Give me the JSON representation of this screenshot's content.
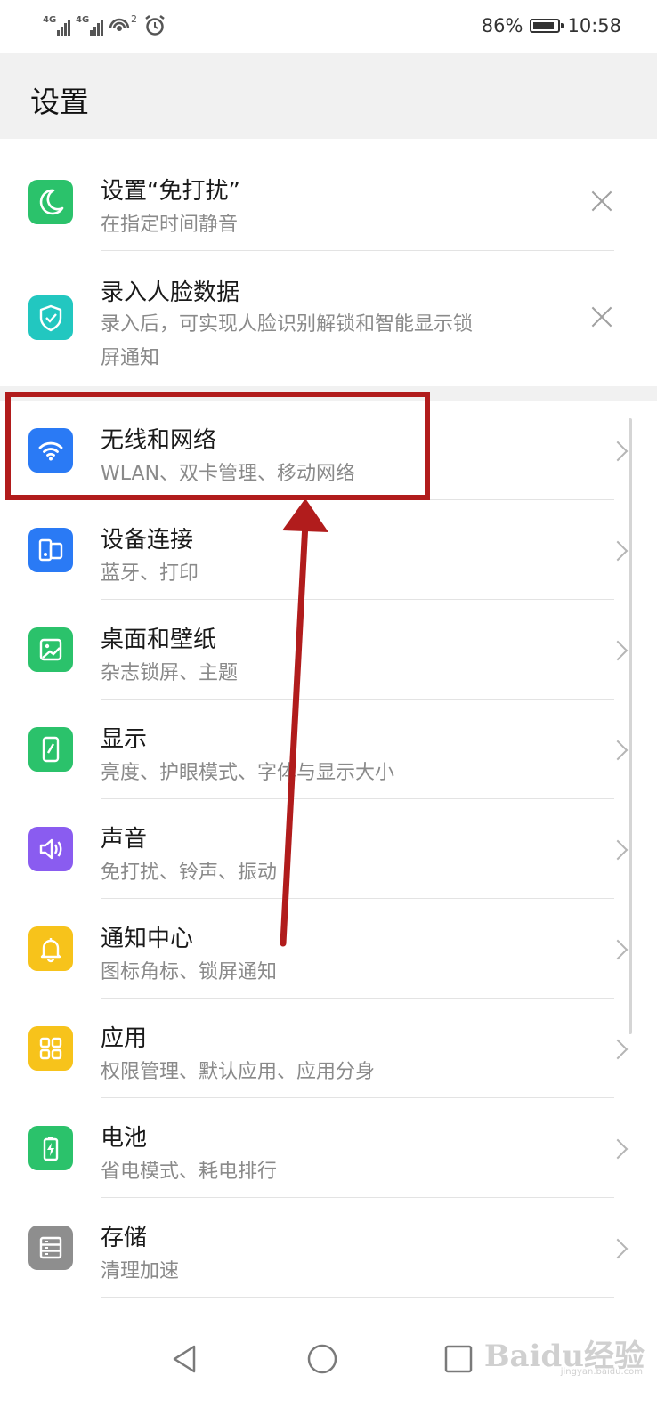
{
  "status_bar": {
    "network_1": "4G",
    "network_2": "4G",
    "hotspot_count": "2",
    "battery_percent": "86%",
    "battery_level": 0.86,
    "time": "10:58"
  },
  "header": {
    "title": "设置"
  },
  "suggestions": [
    {
      "title": "设置“免打扰”",
      "subtitle": "在指定时间静音",
      "icon": "moon-icon",
      "icon_color": "#2bc26b"
    },
    {
      "title": "录入人脸数据",
      "subtitle_line1": "录入后，可实现人脸识别解锁和智能显示锁",
      "subtitle_line2": "屏通知",
      "icon": "shield-check-icon",
      "icon_color": "#22c7c0"
    }
  ],
  "settings": [
    {
      "key": "wireless",
      "title": "无线和网络",
      "subtitle": "WLAN、双卡管理、移动网络",
      "icon": "wifi-icon",
      "icon_color": "#2a7af5"
    },
    {
      "key": "device",
      "title": "设备连接",
      "subtitle": "蓝牙、打印",
      "icon": "device-connection-icon",
      "icon_color": "#2a7af5"
    },
    {
      "key": "desktop",
      "title": "桌面和壁纸",
      "subtitle": "杂志锁屏、主题",
      "icon": "wallpaper-icon",
      "icon_color": "#2bc26b"
    },
    {
      "key": "display",
      "title": "显示",
      "subtitle": "亮度、护眼模式、字体与显示大小",
      "icon": "display-icon",
      "icon_color": "#2bc26b"
    },
    {
      "key": "sound",
      "title": "声音",
      "subtitle": "免打扰、铃声、振动",
      "icon": "speaker-icon",
      "icon_color": "#8a5cf0"
    },
    {
      "key": "notification",
      "title": "通知中心",
      "subtitle": "图标角标、锁屏通知",
      "icon": "bell-icon",
      "icon_color": "#f7c31b"
    },
    {
      "key": "apps",
      "title": "应用",
      "subtitle": "权限管理、默认应用、应用分身",
      "icon": "apps-grid-icon",
      "icon_color": "#f7c31b"
    },
    {
      "key": "battery",
      "title": "电池",
      "subtitle": "省电模式、耗电排行",
      "icon": "battery-icon",
      "icon_color": "#2bc26b"
    },
    {
      "key": "storage",
      "title": "存储",
      "subtitle": "清理加速",
      "icon": "storage-icon",
      "icon_color": "#8e8e8e"
    }
  ],
  "annotation": {
    "color": "#b11c1c"
  },
  "watermark": {
    "text": "Baidu经验",
    "small": "jingyan.baidu.com"
  }
}
